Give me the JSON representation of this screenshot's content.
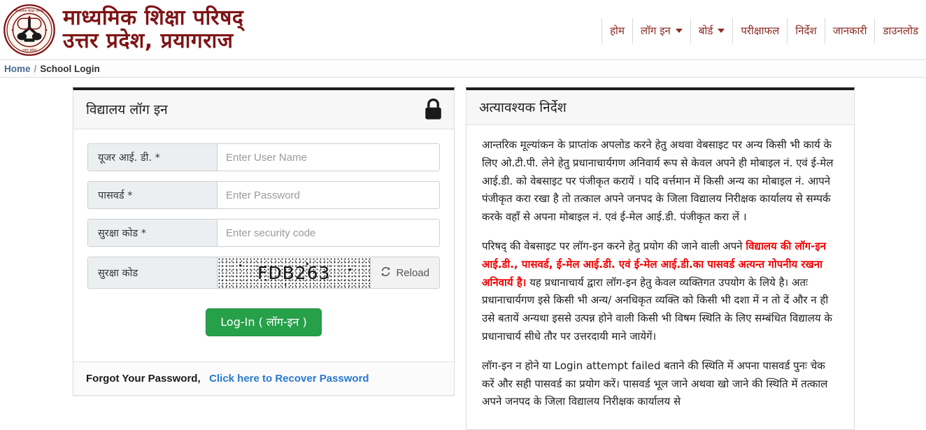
{
  "header": {
    "emblem_alt": "upmsp-seal-emblem",
    "brand_line1": "माध्यमिक शिक्षा परिषद्",
    "brand_line2": "उत्तर प्रदेश, प्रयागराज",
    "nav": [
      {
        "label": "होम",
        "has_caret": false
      },
      {
        "label": "लॉग इन",
        "has_caret": true
      },
      {
        "label": "बोर्ड",
        "has_caret": true
      },
      {
        "label": "परीक्षाफल",
        "has_caret": false
      },
      {
        "label": "निर्देश",
        "has_caret": false
      },
      {
        "label": "जानकारी",
        "has_caret": false
      },
      {
        "label": "डाउनलोड",
        "has_caret": false
      }
    ],
    "nav_text_color": "#8a2a22",
    "brand_color": "#7e1416"
  },
  "breadcrumb": {
    "home": "Home",
    "separator": "/",
    "current": "School Login",
    "link_color": "#4a6c95"
  },
  "login_panel": {
    "title": "विद्यालय लॉग इन",
    "lock_icon": "lock-icon",
    "fields": [
      {
        "label": "यूजर आई. डी. *",
        "placeholder": "Enter User Name",
        "value": "",
        "type": "text",
        "name": "user-id-field"
      },
      {
        "label": "पासवर्ड *",
        "placeholder": "Enter Password",
        "value": "",
        "type": "password",
        "name": "password-field"
      },
      {
        "label": "सुरक्षा कोड *",
        "placeholder": "Enter security code",
        "value": "",
        "type": "text",
        "name": "security-code-field"
      }
    ],
    "captcha": {
      "label": "सुरक्षा कोड",
      "code": "FDB263",
      "reload_label": "Reload",
      "reload_icon": "refresh-icon"
    },
    "submit_label": "Log-In ( लॉग-इन )",
    "submit_color": "#27a04a",
    "footer_text": "Forgot Your Password,",
    "footer_link": "Click here to Recover Password"
  },
  "notice_panel": {
    "title": "अत्यावश्यक निर्देश",
    "para1": "आन्तरिक मूल्यांकन के प्राप्तांक अपलोड करने हेतु अथवा वेबसाइट पर अन्य किसी भी कार्य के लिए ओ.टी.पी. लेने हेतु प्रधानाचार्यगण अनिवार्य रूप से केवल अपने ही मोबाइल नं. एवं ई-मेल आई.डी. को वेबसाइट पर पंजीकृत करायें । यदि वर्त्तमान में किसी अन्य का मोबाइल नं. आपने पंजीकृत करा रखा है तो तत्काल अपने जनपद के जिला विद्यालय निरीक्षक कार्यालय से सम्पर्क करके वहाँ से अपना मोबाइल नं. एवं ई-मेल आई.डी. पंजीकृत करा लें ।",
    "para2_pre": "परिषद् की वेबसाइट पर लॉग-इन करने हेतु प्रयोग की जाने वाली अपने ",
    "para2_red": "विद्यालय की लॉग-इन आई.डी., पासवर्ड, ई-मेल आई.डी. एवं ई-मेल आई.डी.का पासवर्ड अत्यन्त गोपनीय रखना अनिवार्य है।",
    "para2_post": " यह प्रधानाचार्य द्वारा लॉग-इन हेतु केवल व्यक्तिगत उपयोग के लिये है। अतः प्रधानाचार्यगण इसे किसी भी अन्य/ अनधिकृत व्यक्ति को किसी भी दशा में न तो दें और न ही उसे बतायें अन्यथा इससे उत्पन्न होने वाली किसी भी विषम स्थिति के लिए सम्बंधित विद्यालय के प्रधानाचार्य सीधे तौर पर उत्तरदायी माने जायेगें।",
    "para3": "लॉग-इन न होने या Login attempt failed बताने की स्थिति में अपना पासवर्ड पुनः चेक करें और सही पासवर्ड का प्रयोग करें। पासवर्ड भूल जाने अथवा खो जाने की स्थिति में तत्काल अपने जनपद के जिला विद्यालय निरीक्षक कार्यालय से",
    "red_color": "#ee0000"
  }
}
